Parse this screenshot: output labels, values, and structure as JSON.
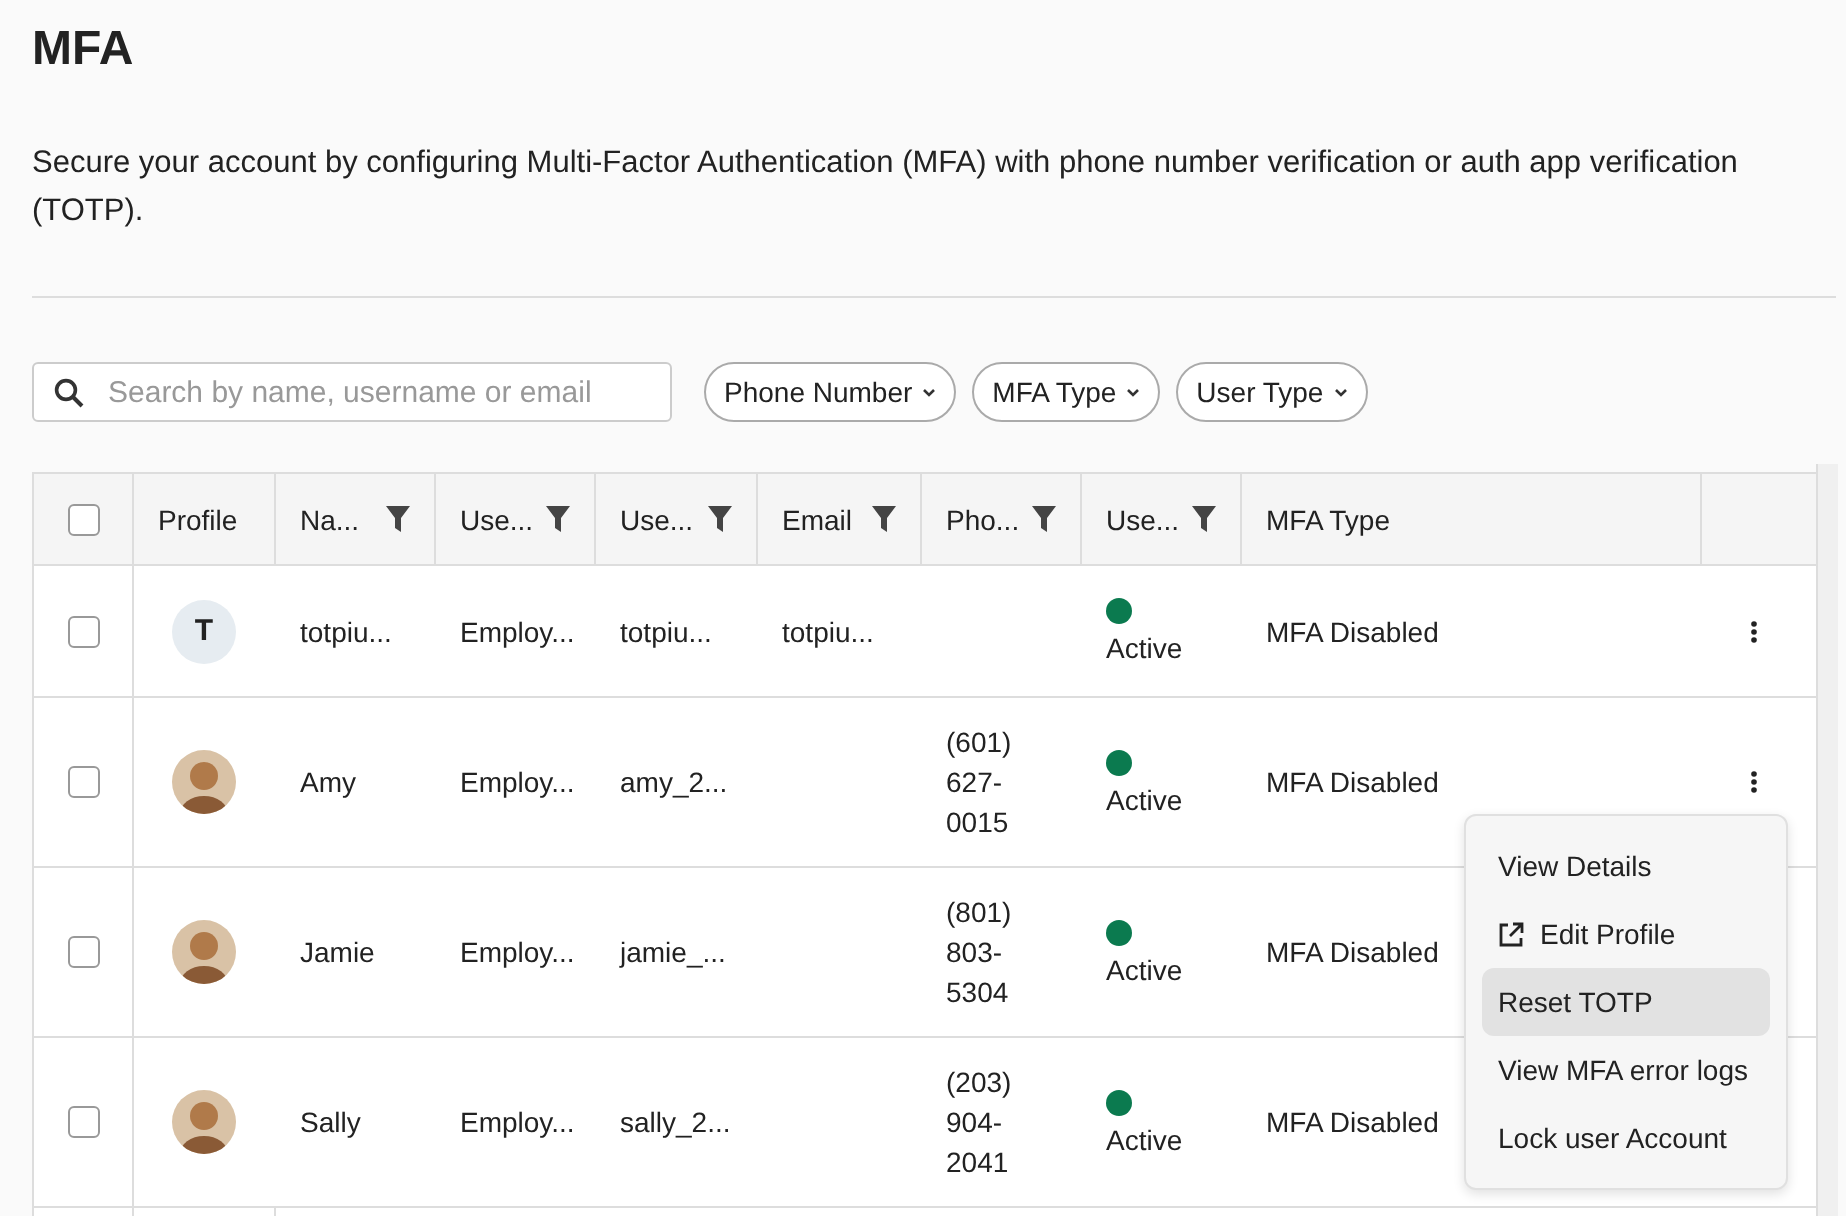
{
  "page": {
    "title": "MFA",
    "description": "Secure your account by configuring Multi-Factor Authentication (MFA) with phone number verification or auth app verification (TOTP)."
  },
  "search": {
    "placeholder": "Search by name, username or email"
  },
  "filters": [
    "Phone Number",
    "MFA Type",
    "User Type"
  ],
  "table": {
    "select_all_checked": false,
    "columns": [
      {
        "label": "Profile",
        "filter": false
      },
      {
        "label": "Na...",
        "filter": true
      },
      {
        "label": "Use...",
        "filter": true
      },
      {
        "label": "Use...",
        "filter": true
      },
      {
        "label": "Email",
        "filter": true
      },
      {
        "label": "Pho...",
        "filter": true
      },
      {
        "label": "Use...",
        "filter": true
      },
      {
        "label": "MFA Type",
        "filter": false
      }
    ],
    "rows": [
      {
        "checked": false,
        "profile": {
          "kind": "initial",
          "text": "T"
        },
        "name": "totpiu...",
        "user_type": "Employ...",
        "username": "totpiu...",
        "email": "totpiu...",
        "phone": [],
        "status": "Active",
        "mfa_type": "MFA Disabled",
        "menu_button": true
      },
      {
        "checked": false,
        "profile": {
          "kind": "photo"
        },
        "name": "Amy",
        "user_type": "Employ...",
        "username": "amy_2...",
        "email": "",
        "phone": [
          "(601)",
          "627-",
          "0015"
        ],
        "status": "Active",
        "mfa_type": "MFA Disabled",
        "menu_button": true
      },
      {
        "checked": false,
        "profile": {
          "kind": "photo"
        },
        "name": "Jamie",
        "user_type": "Employ...",
        "username": "jamie_...",
        "email": "",
        "phone": [
          "(801)",
          "803-",
          "5304"
        ],
        "status": "Active",
        "mfa_type": "MFA Disabled",
        "menu_button": false
      },
      {
        "checked": false,
        "profile": {
          "kind": "photo"
        },
        "name": "Sally",
        "user_type": "Employ...",
        "username": "sally_2...",
        "email": "",
        "phone": [
          "(203)",
          "904-",
          "2041"
        ],
        "status": "Active",
        "mfa_type": "MFA Disabled",
        "menu_button": false
      }
    ]
  },
  "row_menu": {
    "items": [
      {
        "label": "View Details",
        "kind": "plain",
        "selected": false
      },
      {
        "label": "Edit Profile",
        "kind": "link",
        "selected": false
      },
      {
        "label": "Reset TOTP",
        "kind": "plain",
        "selected": true
      },
      {
        "label": "View MFA error logs",
        "kind": "plain",
        "selected": false
      },
      {
        "label": "Lock user Account",
        "kind": "plain",
        "selected": false
      }
    ]
  }
}
